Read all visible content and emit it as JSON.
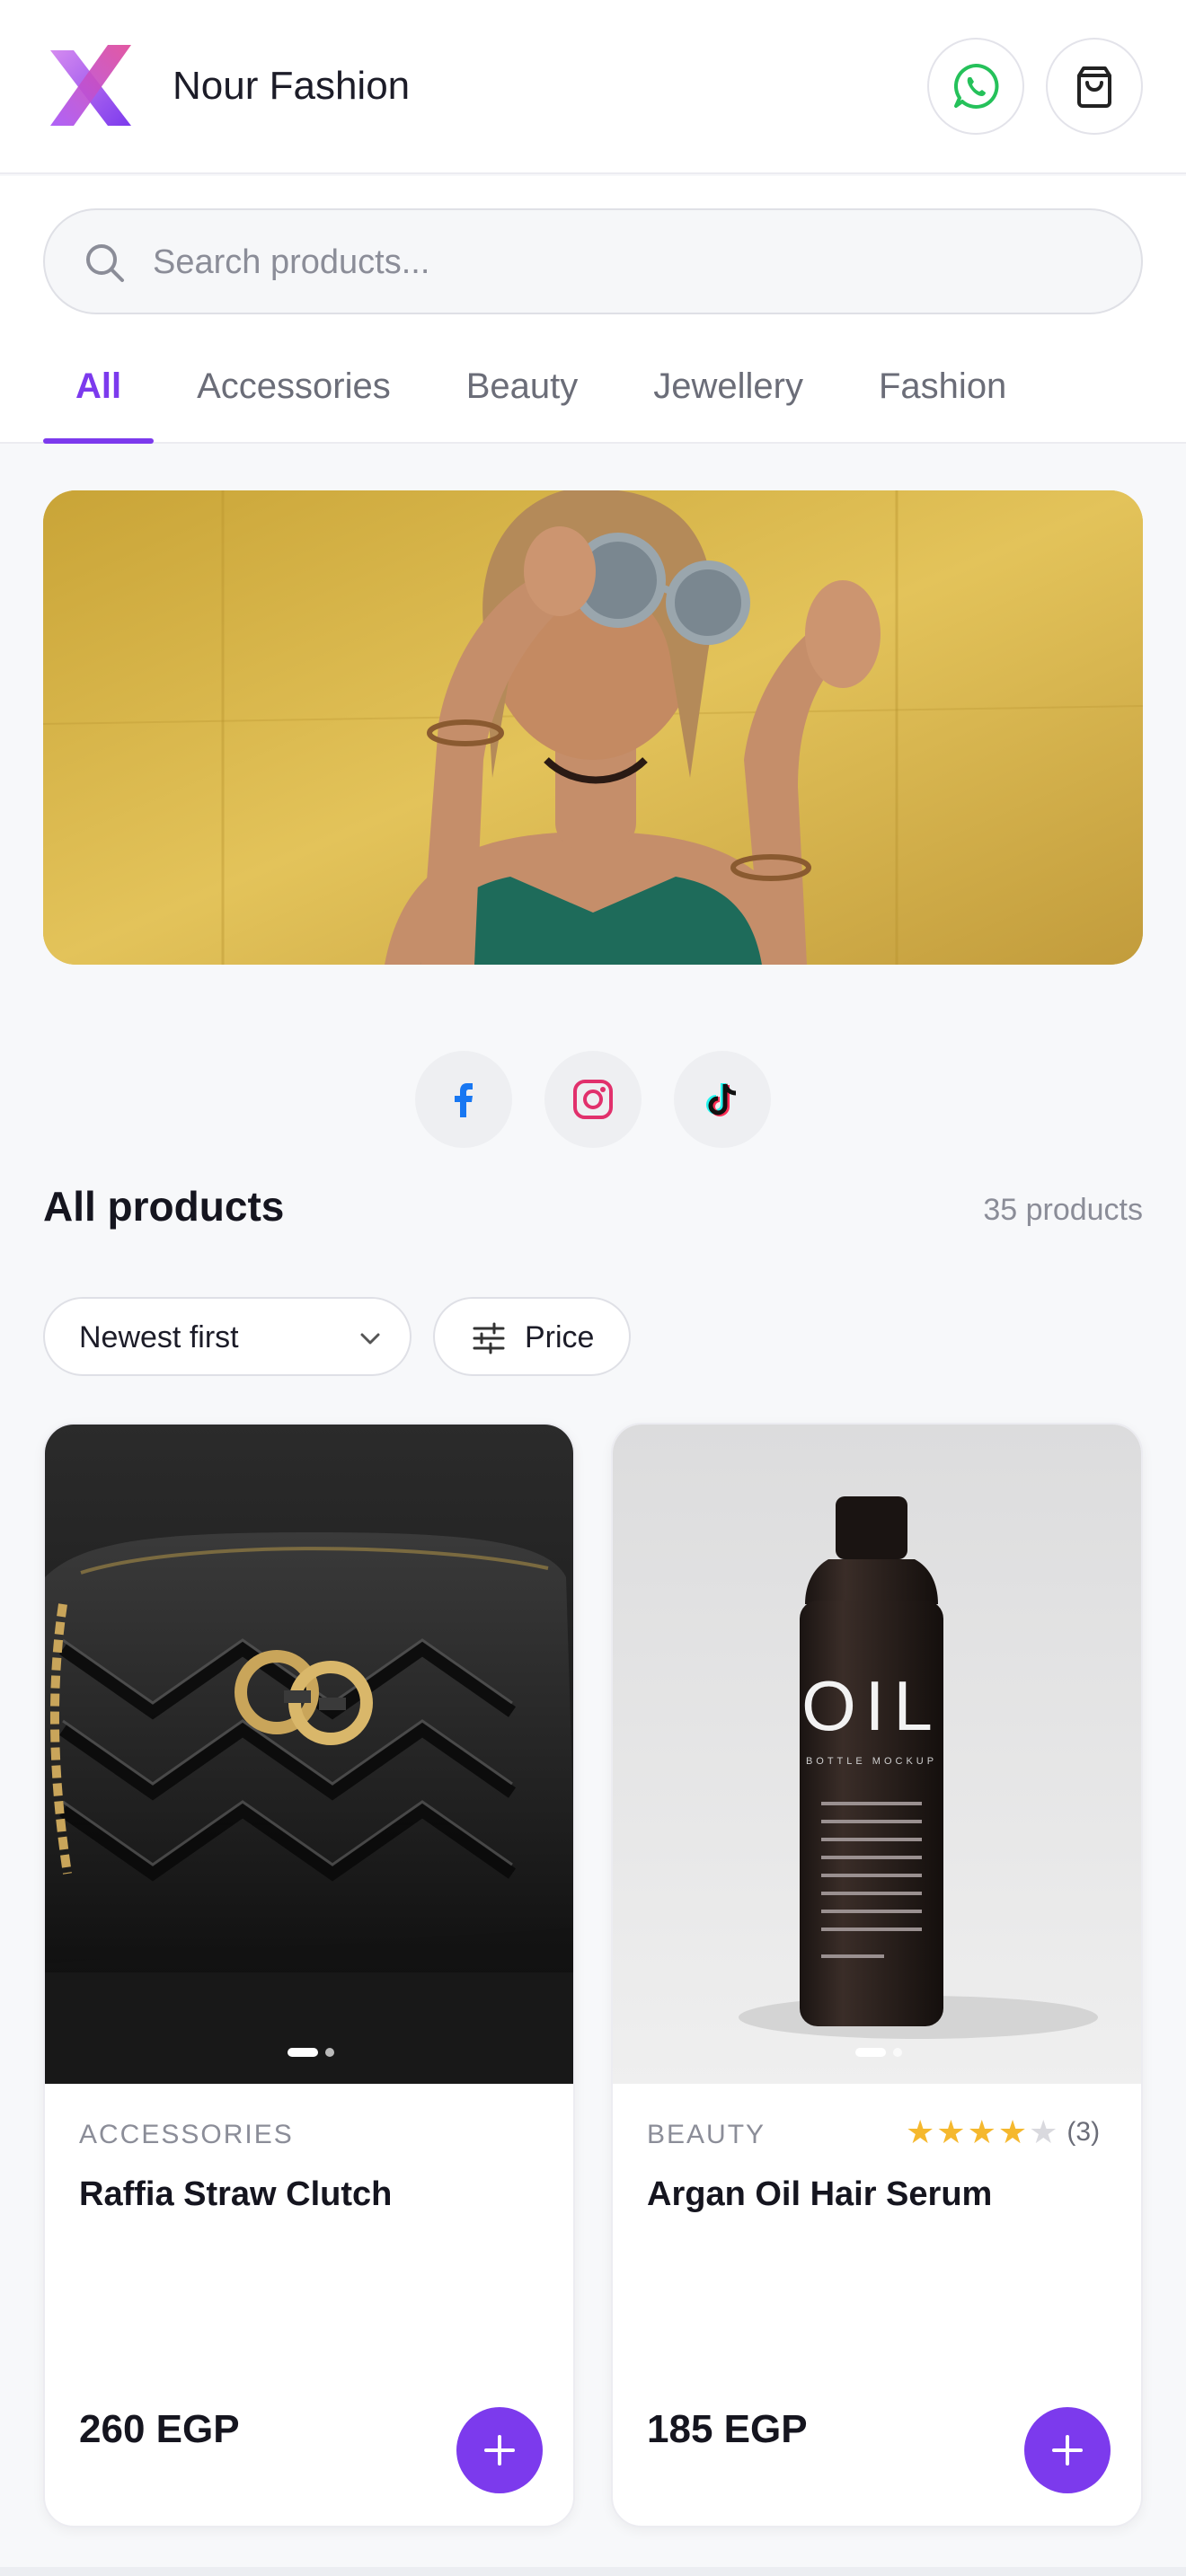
{
  "header": {
    "brand_name": "Nour Fashion",
    "accent_color": "#7c3aed",
    "whatsapp_icon": "whatsapp-icon",
    "cart_icon": "shopping-bag-icon"
  },
  "search": {
    "placeholder": "Search products...",
    "value": ""
  },
  "tabs": [
    {
      "label": "All",
      "active": true
    },
    {
      "label": "Accessories",
      "active": false
    },
    {
      "label": "Beauty",
      "active": false
    },
    {
      "label": "Jewellery",
      "active": false
    },
    {
      "label": "Fashion",
      "active": false
    }
  ],
  "banner": {
    "image": "woman-in-round-sunglasses-on-yellow-wall"
  },
  "social": [
    {
      "name": "facebook-icon",
      "color": "#1877f2"
    },
    {
      "name": "instagram-icon",
      "color": "#e1306c"
    },
    {
      "name": "tiktok-icon",
      "color": "#111111"
    }
  ],
  "products_section": {
    "title": "All products",
    "count_label": "35 products",
    "sort_selected": "Newest first",
    "price_filter_label": "Price"
  },
  "products": [
    {
      "category": "ACCESSORIES",
      "name": "Raffia Straw Clutch",
      "price": "260 EGP",
      "image": "black-quilted-handbag",
      "slides": 2,
      "active_slide": 1
    },
    {
      "category": "BEAUTY",
      "name": "Argan Oil Hair Serum",
      "price": "185 EGP",
      "rating": 4,
      "rating_max": 5,
      "rating_count": "(3)",
      "image": "black-oil-bottle",
      "bottle_text": "OIL",
      "bottle_subtext": "BOTTLE MOCKUP",
      "slides": 2,
      "active_slide": 1
    }
  ],
  "colors": {
    "star_filled": "#f5b82e",
    "star_empty": "#d9d9de"
  }
}
